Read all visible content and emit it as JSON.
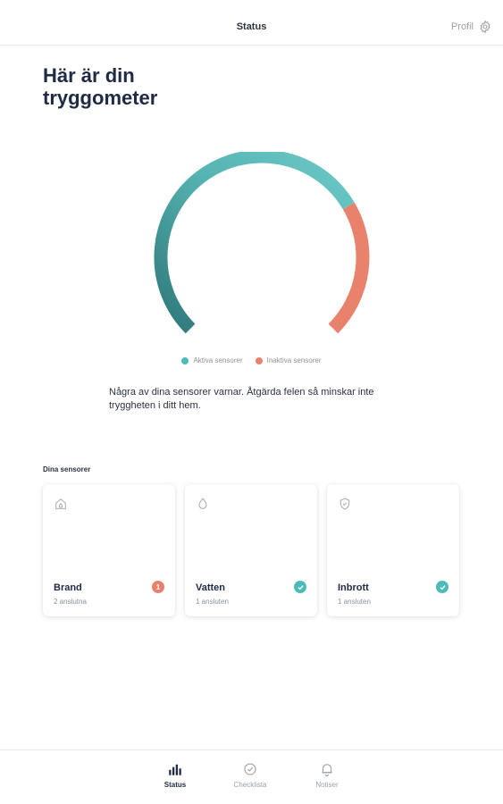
{
  "header": {
    "title": "Status",
    "profile_label": "Profil"
  },
  "main": {
    "heading": "Här är din\ntryggometer",
    "gauge": {
      "active_fraction": 0.72,
      "inactive_fraction": 0.28
    },
    "legend": {
      "active_label": "Aktiva sensorer",
      "inactive_label": "Inaktiva sensorer"
    },
    "warning_text": "Några av dina sensorer varnar. Åtgärda felen så minskar inte tryggheten i ditt hem.",
    "sensors_label": "Dina sensorer",
    "sensors": [
      {
        "name": "Brand",
        "status": "2 anslutna",
        "icon": "house-icon",
        "badge": "1",
        "badge_type": "warning"
      },
      {
        "name": "Vatten",
        "status": "1 ansluten",
        "icon": "water-drop-icon",
        "badge": "",
        "badge_type": "ok"
      },
      {
        "name": "Inbrott",
        "status": "1 ansluten",
        "icon": "shield-icon",
        "badge": "",
        "badge_type": "ok"
      }
    ]
  },
  "nav": {
    "tabs": [
      {
        "label": "Status",
        "icon": "bar-chart-icon",
        "active": true
      },
      {
        "label": "Checklista",
        "icon": "check-circle-icon",
        "active": false
      },
      {
        "label": "Notiser",
        "icon": "bell-icon",
        "active": false
      }
    ]
  },
  "colors": {
    "active_light": "#6cc9c7",
    "active_dark": "#2f7779",
    "inactive": "#e9826d",
    "ok_badge": "#4cbcb9",
    "warning_badge": "#e9826d"
  }
}
